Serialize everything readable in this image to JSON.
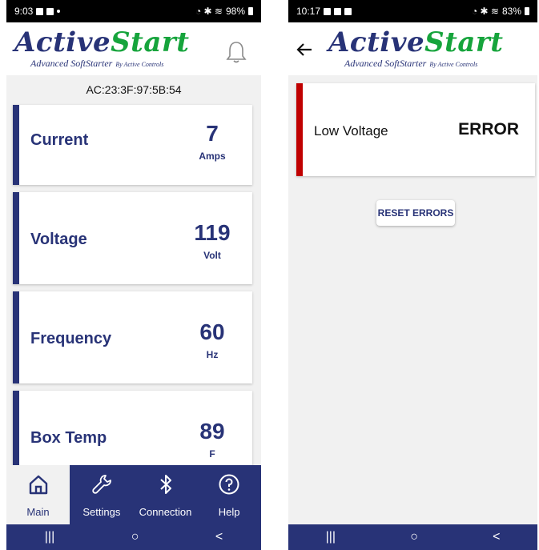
{
  "colors": {
    "brand_navy": "#283377",
    "brand_green": "#16a43c",
    "error_red": "#c00000",
    "background": "#f1f1f1"
  },
  "left_screen": {
    "status_bar": {
      "time": "9:03",
      "battery": "98%"
    },
    "logo": {
      "word1": "Active",
      "word2": "Start",
      "tagline": "Advanced SoftStarter",
      "by_line": "By Active Controls"
    },
    "header_icons": [
      "bell-icon"
    ],
    "device_id": "AC:23:3F:97:5B:54",
    "readings": [
      {
        "label": "Current",
        "value": "7",
        "unit": "Amps"
      },
      {
        "label": "Voltage",
        "value": "119",
        "unit": "Volt"
      },
      {
        "label": "Frequency",
        "value": "60",
        "unit": "Hz"
      },
      {
        "label": "Box Temp",
        "value": "89",
        "unit": "F"
      }
    ],
    "bottom_nav": [
      {
        "label": "Main",
        "icon": "home-icon",
        "active": true
      },
      {
        "label": "Settings",
        "icon": "wrench-icon",
        "active": false
      },
      {
        "label": "Connection",
        "icon": "bluetooth-icon",
        "active": false
      },
      {
        "label": "Help",
        "icon": "help-icon",
        "active": false
      }
    ],
    "system_nav": {
      "recents": "|||",
      "home": "○",
      "back": "<"
    }
  },
  "right_screen": {
    "status_bar": {
      "time": "10:17",
      "battery": "83%"
    },
    "logo": {
      "word1": "Active",
      "word2": "Start",
      "tagline": "Advanced SoftStarter",
      "by_line": "By Active Controls"
    },
    "header_icons": [
      "back-arrow-icon"
    ],
    "error_card": {
      "label": "Low Voltage",
      "status": "ERROR"
    },
    "reset_button": "RESET ERRORS",
    "system_nav": {
      "recents": "|||",
      "home": "○",
      "back": "<"
    }
  }
}
